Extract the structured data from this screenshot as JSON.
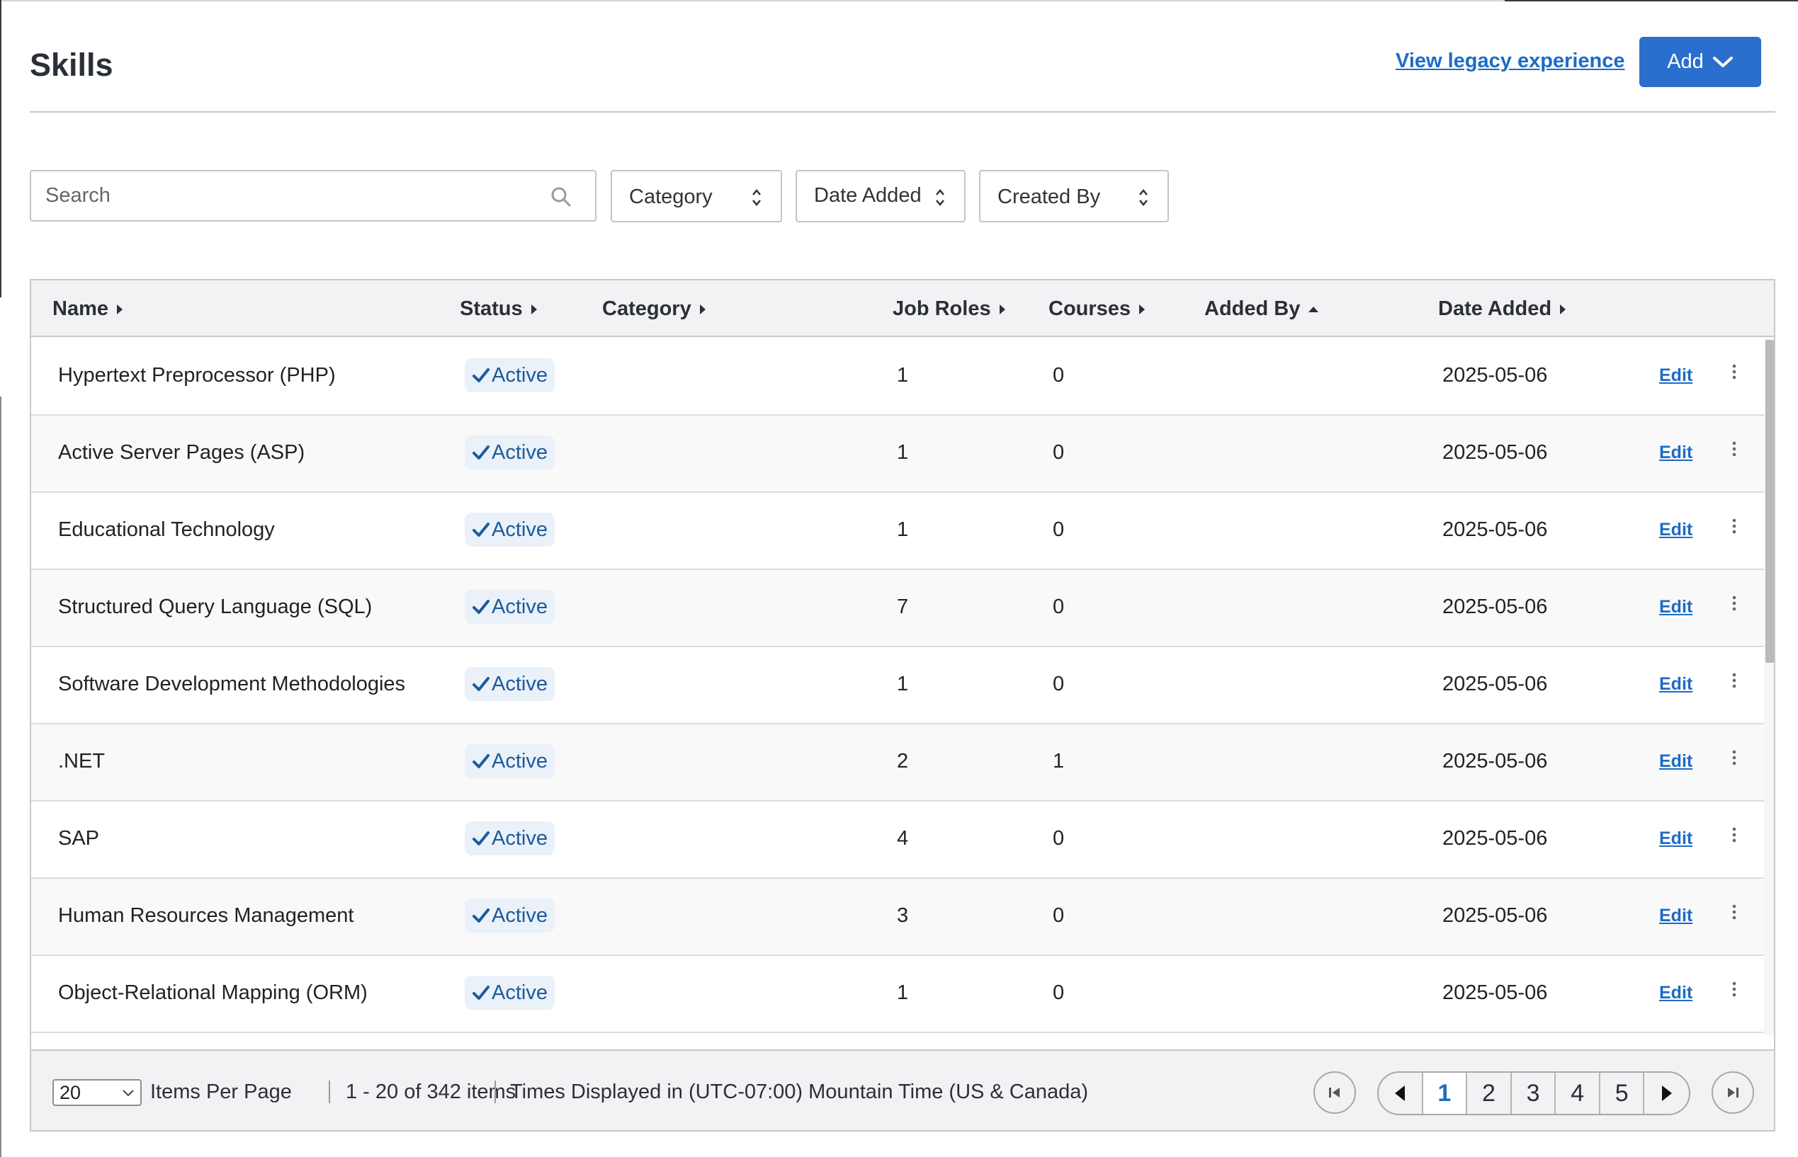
{
  "header": {
    "title": "Skills",
    "legacy_link": "View legacy experience",
    "add_label": "Add"
  },
  "filters": {
    "search_placeholder": "Search",
    "category_label": "Category",
    "date_added_label": "Date Added",
    "created_by_label": "Created By"
  },
  "table": {
    "columns": [
      "Name",
      "Status",
      "Category",
      "Job Roles",
      "Courses",
      "Added By",
      "Date Added"
    ],
    "sort": {
      "column": "Added By",
      "direction": "ascending"
    },
    "edit_label": "Edit",
    "rows": [
      {
        "name": "Hypertext Preprocessor (PHP)",
        "status": "Active",
        "category": "",
        "job_roles": "1",
        "courses": "0",
        "added_by": "",
        "date_added": "2025-05-06"
      },
      {
        "name": "Active Server Pages (ASP)",
        "status": "Active",
        "category": "",
        "job_roles": "1",
        "courses": "0",
        "added_by": "",
        "date_added": "2025-05-06"
      },
      {
        "name": "Educational Technology",
        "status": "Active",
        "category": "",
        "job_roles": "1",
        "courses": "0",
        "added_by": "",
        "date_added": "2025-05-06"
      },
      {
        "name": "Structured Query Language (SQL)",
        "status": "Active",
        "category": "",
        "job_roles": "7",
        "courses": "0",
        "added_by": "",
        "date_added": "2025-05-06"
      },
      {
        "name": "Software Development Methodologies",
        "status": "Active",
        "category": "",
        "job_roles": "1",
        "courses": "0",
        "added_by": "",
        "date_added": "2025-05-06"
      },
      {
        "name": ".NET",
        "status": "Active",
        "category": "",
        "job_roles": "2",
        "courses": "1",
        "added_by": "",
        "date_added": "2025-05-06"
      },
      {
        "name": "SAP",
        "status": "Active",
        "category": "",
        "job_roles": "4",
        "courses": "0",
        "added_by": "",
        "date_added": "2025-05-06"
      },
      {
        "name": "Human Resources Management",
        "status": "Active",
        "category": "",
        "job_roles": "3",
        "courses": "0",
        "added_by": "",
        "date_added": "2025-05-06"
      },
      {
        "name": "Object-Relational Mapping (ORM)",
        "status": "Active",
        "category": "",
        "job_roles": "1",
        "courses": "0",
        "added_by": "",
        "date_added": "2025-05-06"
      }
    ]
  },
  "footer": {
    "per_page_value": "20",
    "per_page_label": "Items Per Page",
    "range_text": "1 - 20 of 342 items",
    "timezone_text": "Times Displayed in (UTC-07:00) Mountain Time (US & Canada)",
    "pages": [
      "1",
      "2",
      "3",
      "4",
      "5"
    ],
    "current_page": "1"
  },
  "colors": {
    "accent": "#2a6fce",
    "link": "#1e6bc4",
    "status_bg": "#eaf1f8",
    "status_text": "#1d5a9c"
  },
  "icons": {
    "search": "search-icon",
    "dropdown": "chevron-down-icon",
    "sort": "sort-arrow-icon",
    "status": "check-icon",
    "row_menu": "more-vertical-icon",
    "first": "first-page-icon",
    "prev": "prev-page-icon",
    "next": "next-page-icon",
    "last": "last-page-icon"
  }
}
